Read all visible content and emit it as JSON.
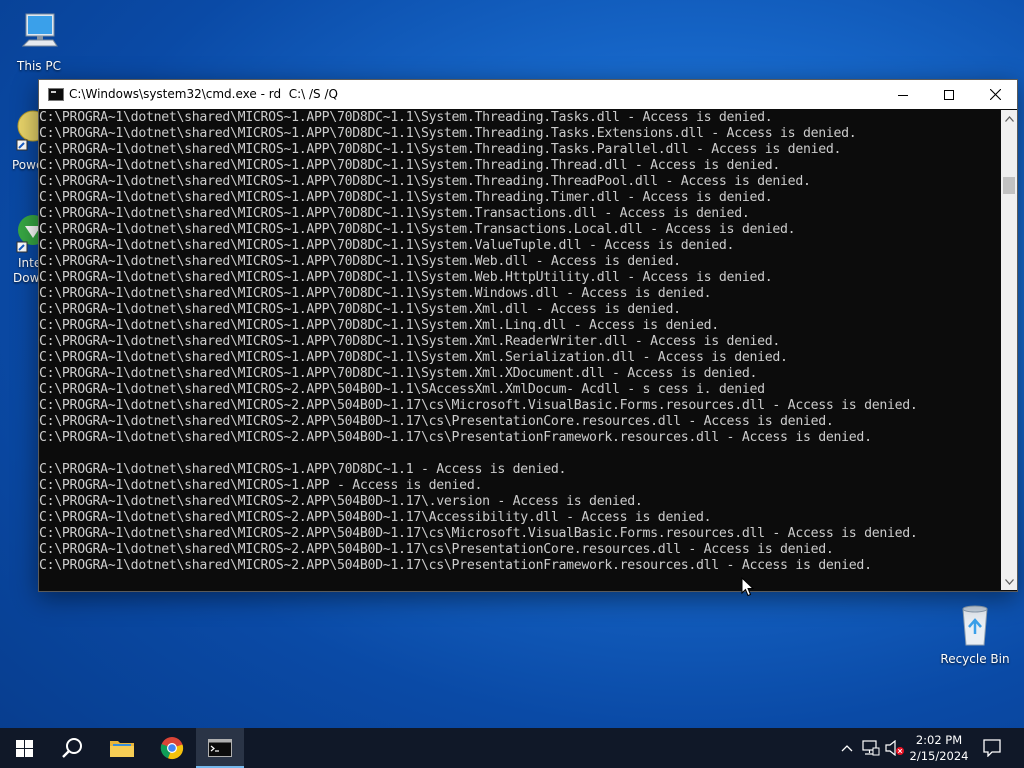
{
  "desktop": {
    "icons": [
      {
        "name": "This PC"
      },
      {
        "name": "Recycle Bin"
      }
    ],
    "partial_labels": [
      "Powe",
      "Inte",
      "Dow"
    ]
  },
  "window": {
    "title": "C:\\Windows\\system32\\cmd.exe - rd  C:\\ /S /Q",
    "lines": [
      "C:\\PROGRA~1\\dotnet\\shared\\MICROS~1.APP\\70D8DC~1.1\\System.Threading.Tasks.dll - Access is denied.",
      "C:\\PROGRA~1\\dotnet\\shared\\MICROS~1.APP\\70D8DC~1.1\\System.Threading.Tasks.Extensions.dll - Access is denied.",
      "C:\\PROGRA~1\\dotnet\\shared\\MICROS~1.APP\\70D8DC~1.1\\System.Threading.Tasks.Parallel.dll - Access is denied.",
      "C:\\PROGRA~1\\dotnet\\shared\\MICROS~1.APP\\70D8DC~1.1\\System.Threading.Thread.dll - Access is denied.",
      "C:\\PROGRA~1\\dotnet\\shared\\MICROS~1.APP\\70D8DC~1.1\\System.Threading.ThreadPool.dll - Access is denied.",
      "C:\\PROGRA~1\\dotnet\\shared\\MICROS~1.APP\\70D8DC~1.1\\System.Threading.Timer.dll - Access is denied.",
      "C:\\PROGRA~1\\dotnet\\shared\\MICROS~1.APP\\70D8DC~1.1\\System.Transactions.dll - Access is denied.",
      "C:\\PROGRA~1\\dotnet\\shared\\MICROS~1.APP\\70D8DC~1.1\\System.Transactions.Local.dll - Access is denied.",
      "C:\\PROGRA~1\\dotnet\\shared\\MICROS~1.APP\\70D8DC~1.1\\System.ValueTuple.dll - Access is denied.",
      "C:\\PROGRA~1\\dotnet\\shared\\MICROS~1.APP\\70D8DC~1.1\\System.Web.dll - Access is denied.",
      "C:\\PROGRA~1\\dotnet\\shared\\MICROS~1.APP\\70D8DC~1.1\\System.Web.HttpUtility.dll - Access is denied.",
      "C:\\PROGRA~1\\dotnet\\shared\\MICROS~1.APP\\70D8DC~1.1\\System.Windows.dll - Access is denied.",
      "C:\\PROGRA~1\\dotnet\\shared\\MICROS~1.APP\\70D8DC~1.1\\System.Xml.dll - Access is denied.",
      "C:\\PROGRA~1\\dotnet\\shared\\MICROS~1.APP\\70D8DC~1.1\\System.Xml.Linq.dll - Access is denied.",
      "C:\\PROGRA~1\\dotnet\\shared\\MICROS~1.APP\\70D8DC~1.1\\System.Xml.ReaderWriter.dll - Access is denied.",
      "C:\\PROGRA~1\\dotnet\\shared\\MICROS~1.APP\\70D8DC~1.1\\System.Xml.Serialization.dll - Access is denied.",
      "C:\\PROGRA~1\\dotnet\\shared\\MICROS~1.APP\\70D8DC~1.1\\System.Xml.XDocument.dll - Access is denied.",
      "C:\\PROGRA~1\\dotnet\\shared\\MICROS~2.APP\\504B0D~1.1\\SAccessXml.XmlDocum- Acdll - s cess i. denied",
      "C:\\PROGRA~1\\dotnet\\shared\\MICROS~2.APP\\504B0D~1.17\\cs\\Microsoft.VisualBasic.Forms.resources.dll - Access is denied.",
      "C:\\PROGRA~1\\dotnet\\shared\\MICROS~2.APP\\504B0D~1.17\\cs\\PresentationCore.resources.dll - Access is denied.",
      "C:\\PROGRA~1\\dotnet\\shared\\MICROS~2.APP\\504B0D~1.17\\cs\\PresentationFramework.resources.dll - Access is denied.",
      "",
      "C:\\PROGRA~1\\dotnet\\shared\\MICROS~1.APP\\70D8DC~1.1 - Access is denied.",
      "C:\\PROGRA~1\\dotnet\\shared\\MICROS~1.APP - Access is denied.",
      "C:\\PROGRA~1\\dotnet\\shared\\MICROS~2.APP\\504B0D~1.17\\.version - Access is denied.",
      "C:\\PROGRA~1\\dotnet\\shared\\MICROS~2.APP\\504B0D~1.17\\Accessibility.dll - Access is denied.",
      "C:\\PROGRA~1\\dotnet\\shared\\MICROS~2.APP\\504B0D~1.17\\cs\\Microsoft.VisualBasic.Forms.resources.dll - Access is denied.",
      "C:\\PROGRA~1\\dotnet\\shared\\MICROS~2.APP\\504B0D~1.17\\cs\\PresentationCore.resources.dll - Access is denied.",
      "C:\\PROGRA~1\\dotnet\\shared\\MICROS~2.APP\\504B0D~1.17\\cs\\PresentationFramework.resources.dll - Access is denied."
    ],
    "controls": {
      "minimize": "minimize-icon",
      "maximize": "maximize-icon",
      "close": "close-icon"
    }
  },
  "taskbar": {
    "items": [
      "windows-start-icon",
      "search-icon",
      "file-explorer-icon",
      "chrome-icon",
      "cmd-icon"
    ],
    "tray": [
      "chevron-up-icon",
      "network-icon",
      "volume-muted-icon",
      "notification-icon"
    ],
    "clock": {
      "time": "2:02 PM",
      "date": "2/15/2024"
    }
  },
  "colors": {
    "console_bg": "#0c0c0c",
    "console_text": "#cccccc",
    "taskbar": "#101828",
    "accent": "#76b9ed"
  }
}
